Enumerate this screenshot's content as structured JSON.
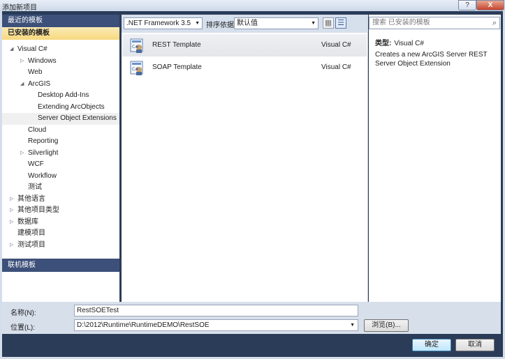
{
  "window": {
    "title": "添加新项目",
    "help_label": "?",
    "close_label": "X"
  },
  "left": {
    "recent_header": "最近的模板",
    "installed_header": "已安装的模板",
    "online_header": "联机模板",
    "tree": [
      {
        "label": "Visual C#",
        "arrow": "◢",
        "indent": 1
      },
      {
        "label": "Windows",
        "arrow": "▷",
        "indent": 2
      },
      {
        "label": "Web",
        "arrow": "",
        "indent": 2
      },
      {
        "label": "ArcGIS",
        "arrow": "◢",
        "indent": 2
      },
      {
        "label": "Desktop Add-Ins",
        "arrow": "",
        "indent": 3
      },
      {
        "label": "Extending ArcObjects",
        "arrow": "",
        "indent": 3
      },
      {
        "label": "Server Object Extensions",
        "arrow": "",
        "indent": 3,
        "selected": true
      },
      {
        "label": "Cloud",
        "arrow": "",
        "indent": 2
      },
      {
        "label": "Reporting",
        "arrow": "",
        "indent": 2
      },
      {
        "label": "Silverlight",
        "arrow": "▷",
        "indent": 2
      },
      {
        "label": "WCF",
        "arrow": "",
        "indent": 2
      },
      {
        "label": "Workflow",
        "arrow": "",
        "indent": 2
      },
      {
        "label": "测试",
        "arrow": "",
        "indent": 2
      },
      {
        "label": "其他语言",
        "arrow": "▷",
        "indent": 1
      },
      {
        "label": "其他项目类型",
        "arrow": "▷",
        "indent": 1
      },
      {
        "label": "数据库",
        "arrow": "▷",
        "indent": 1
      },
      {
        "label": "建模项目",
        "arrow": "",
        "indent": 1
      },
      {
        "label": "测试项目",
        "arrow": "▷",
        "indent": 1
      }
    ]
  },
  "toolbar": {
    "framework": ".NET Framework 3.5",
    "sort_label": "排序依据:",
    "sort_value": "默认值",
    "view_small_icon": "▦",
    "view_list_icon": "☰"
  },
  "templates": [
    {
      "name": "REST Template",
      "lang": "Visual C#",
      "selected": true
    },
    {
      "name": "SOAP Template",
      "lang": "Visual C#",
      "selected": false
    }
  ],
  "right": {
    "search_placeholder": "搜索 已安装的模板",
    "type_label": "类型:",
    "type_value": "Visual C#",
    "description": "Creates a new ArcGIS Server REST Server Object Extension"
  },
  "bottom": {
    "name_label": "名称(N):",
    "name_value": "RestSOETest",
    "location_label": "位置(L):",
    "location_value": "D:\\2012\\Runtime\\RuntimeDEMO\\RestSOE",
    "browse_label": "浏览(B)...",
    "ok_label": "确定",
    "cancel_label": "取消"
  },
  "colors": {
    "header_dark": "#3c5079",
    "header_gold": "#f7d87e",
    "frame": "#2b3c59"
  }
}
